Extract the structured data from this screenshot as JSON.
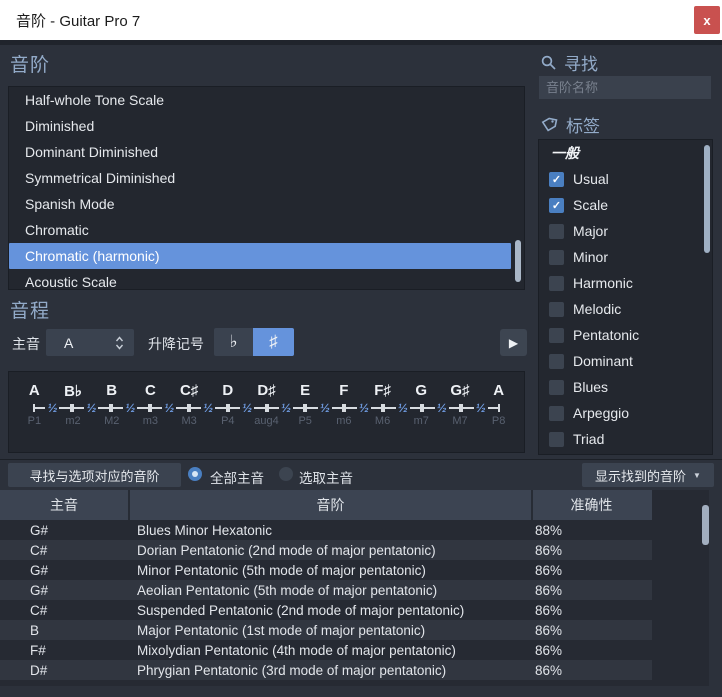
{
  "window": {
    "title": "音阶 - Guitar Pro 7",
    "close_glyph": "x"
  },
  "scales": {
    "heading": "音阶",
    "selected_index": 6,
    "items": [
      "Half-whole Tone Scale",
      "Diminished",
      "Dominant Diminished",
      "Symmetrical Diminished",
      "Spanish Mode",
      "Chromatic",
      "Chromatic (harmonic)",
      "Acoustic Scale"
    ]
  },
  "search": {
    "heading": "寻找",
    "placeholder": "音阶名称"
  },
  "tags": {
    "heading": "标签",
    "group_label": "一般",
    "check_glyph": "✓",
    "items": [
      {
        "label": "Usual",
        "checked": true
      },
      {
        "label": "Scale",
        "checked": true
      },
      {
        "label": "Major",
        "checked": false
      },
      {
        "label": "Minor",
        "checked": false
      },
      {
        "label": "Harmonic",
        "checked": false
      },
      {
        "label": "Melodic",
        "checked": false
      },
      {
        "label": "Pentatonic",
        "checked": false
      },
      {
        "label": "Dominant",
        "checked": false
      },
      {
        "label": "Blues",
        "checked": false
      },
      {
        "label": "Arpeggio",
        "checked": false
      },
      {
        "label": "Triad",
        "checked": false
      }
    ]
  },
  "intervals": {
    "heading": "音程",
    "tonic_label": "主音",
    "tonic_value": "A",
    "accidental_label": "升降记号",
    "flat_symbol": "♭",
    "sharp_symbol": "♯",
    "play_glyph": "▶",
    "step_label": "½",
    "notes": [
      "A",
      "B♭",
      "B",
      "C",
      "C♯",
      "D",
      "D♯",
      "E",
      "F",
      "F♯",
      "G",
      "G♯",
      "A"
    ],
    "interval_names": [
      "P1",
      "m2",
      "M2",
      "m3",
      "M3",
      "P4",
      "aug4",
      "P5",
      "m6",
      "M6",
      "m7",
      "M7",
      "P8"
    ]
  },
  "finder": {
    "find_button": "寻找与选项对应的音阶",
    "radio_all_label": "全部主音",
    "radio_pick_label": "选取主音",
    "radio_all_selected": true,
    "show_found_button": "显示找到的音阶",
    "caret_glyph": "▼"
  },
  "results": {
    "columns": [
      "主音",
      "音阶",
      "准确性"
    ],
    "rows": [
      [
        "G#",
        "Blues Minor Hexatonic",
        "88%"
      ],
      [
        "C#",
        "Dorian Pentatonic (2nd mode of major pentatonic)",
        "86%"
      ],
      [
        "G#",
        "Minor Pentatonic (5th mode of major pentatonic)",
        "86%"
      ],
      [
        "G#",
        "Aeolian Pentatonic (5th mode of major pentatonic)",
        "86%"
      ],
      [
        "C#",
        "Suspended Pentatonic (2nd mode of major pentatonic)",
        "86%"
      ],
      [
        "B",
        "Major Pentatonic (1st mode of major pentatonic)",
        "86%"
      ],
      [
        "F#",
        "Mixolydian Pentatonic (4th mode of major pentatonic)",
        "86%"
      ],
      [
        "D#",
        "Phrygian Pentatonic (3rd mode of major pentatonic)",
        "86%"
      ]
    ]
  },
  "colors": {
    "accent": "#6593dc",
    "checkbox_blue": "#4a7fc1",
    "close_red": "#c9514f"
  }
}
